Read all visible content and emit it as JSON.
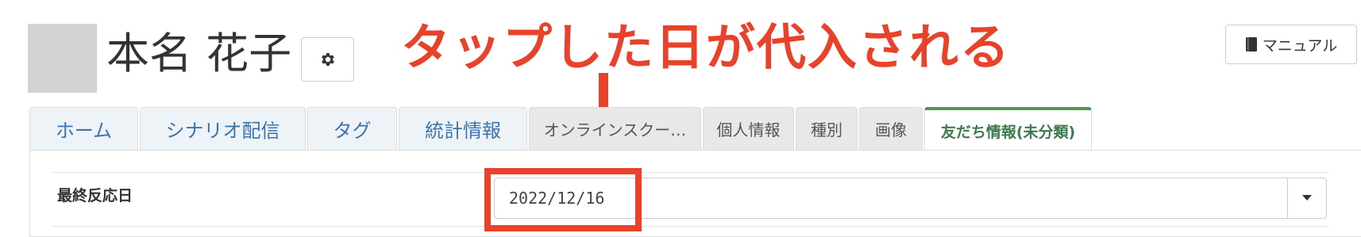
{
  "user": {
    "name": "本名 花子"
  },
  "header": {
    "settings_icon": "gear-icon",
    "manual_label": "マニュアル",
    "manual_icon": "book-icon"
  },
  "annotation": {
    "text": "タップした日が代入される",
    "color": "#e8432a"
  },
  "tabs": [
    {
      "label": "ホーム"
    },
    {
      "label": "シナリオ配信"
    },
    {
      "label": "タグ"
    },
    {
      "label": "統計情報"
    },
    {
      "label": "オンラインスクー…"
    },
    {
      "label": "個人情報"
    },
    {
      "label": "種別"
    },
    {
      "label": "画像"
    },
    {
      "label": "友だち情報(未分類)"
    }
  ],
  "active_tab_index": 8,
  "form": {
    "field_label": "最終反応日",
    "date_value": "2022/12/16"
  },
  "colors": {
    "primary_tab_text": "#3a75ad",
    "active_tab_text": "#3e7a4e",
    "active_tab_border": "#4a9b4f"
  }
}
